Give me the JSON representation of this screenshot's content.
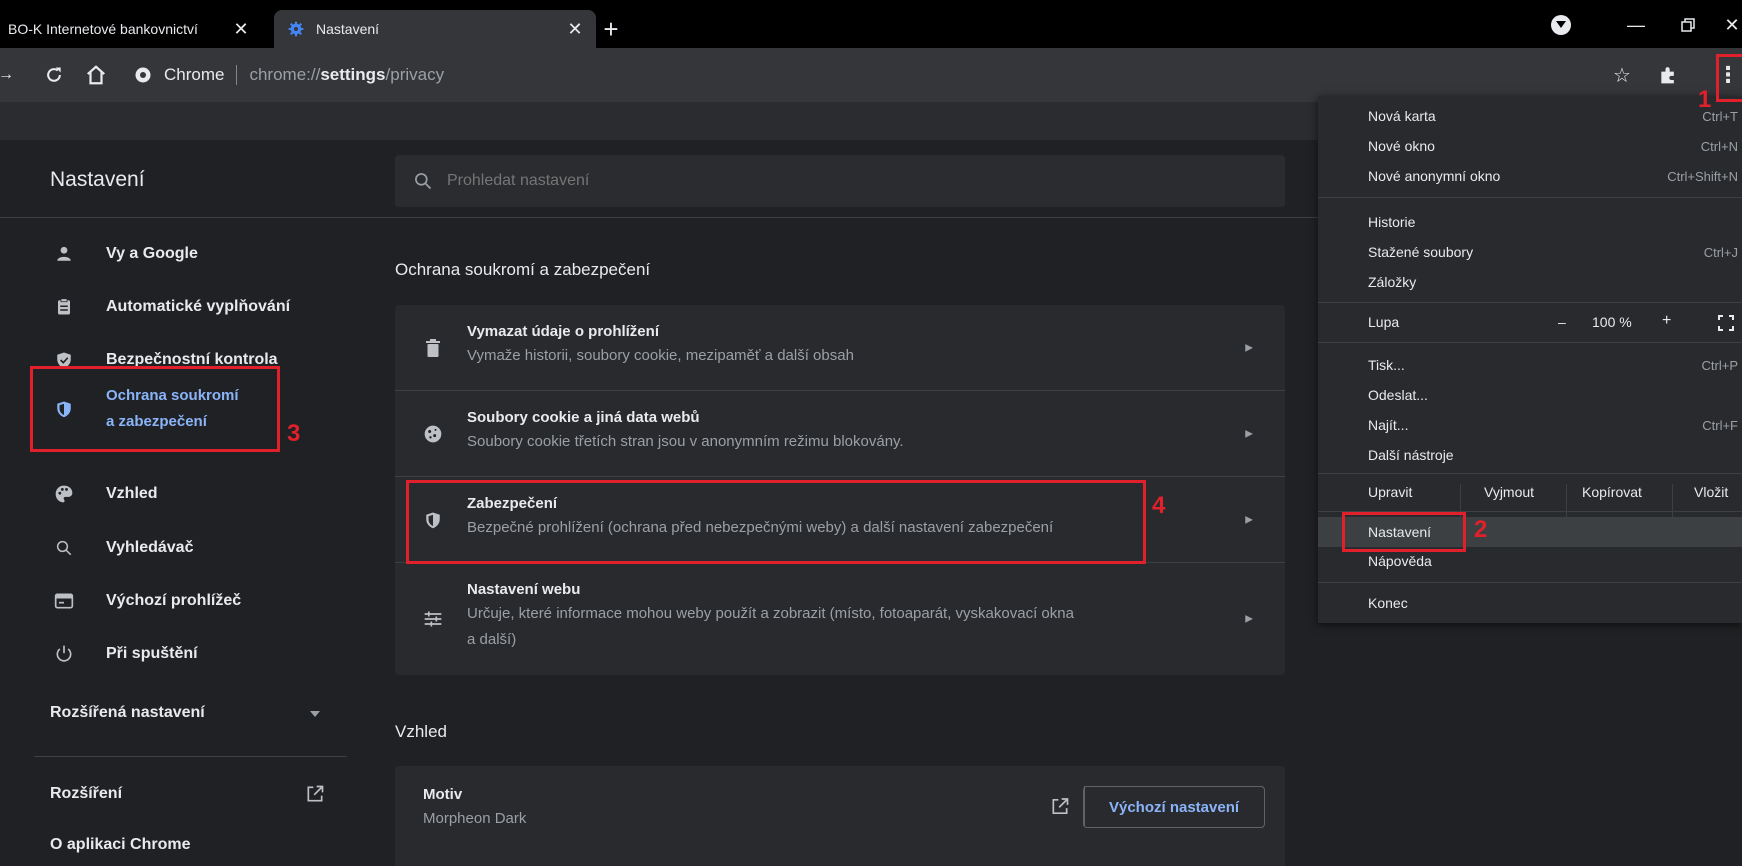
{
  "tabs": [
    {
      "title": "BO-K Internetové bankovnictví"
    },
    {
      "title": "Nastavení"
    }
  ],
  "toolbar": {
    "chrome_label": "Chrome",
    "url_scheme": "chrome://",
    "url_host": "settings",
    "url_path": "/privacy"
  },
  "settings": {
    "title": "Nastavení",
    "search_placeholder": "Prohledat nastavení"
  },
  "sidebar": {
    "items": [
      {
        "label": "Vy a Google",
        "icon": "person-icon"
      },
      {
        "label": "Automatické vyplňování",
        "icon": "clipboard-icon"
      },
      {
        "label": "Bezpečnostní kontrola",
        "icon": "shield-check-icon"
      },
      {
        "label": "Ochrana soukromí",
        "label2": "a zabezpečení",
        "icon": "shield-icon"
      },
      {
        "label": "Vzhled",
        "icon": "palette-icon"
      },
      {
        "label": "Vyhledávač",
        "icon": "search-icon"
      },
      {
        "label": "Výchozí prohlížeč",
        "icon": "browser-icon"
      },
      {
        "label": "Při spuštění",
        "icon": "power-icon"
      }
    ],
    "advanced": "Rozšířená nastavení",
    "extensions": "Rozšíření",
    "about": "O aplikaci Chrome"
  },
  "privacy": {
    "section_title": "Ochrana soukromí a zabezpečení",
    "rows": [
      {
        "title": "Vymazat údaje o prohlížení",
        "subtitle": "Vymaže historii, soubory cookie, mezipaměť a další obsah"
      },
      {
        "title": "Soubory cookie a jiná data webů",
        "subtitle": "Soubory cookie třetích stran jsou v anonymním režimu blokovány."
      },
      {
        "title": "Zabezpečení",
        "subtitle": "Bezpečné prohlížení (ochrana před nebezpečnými weby) a další nastavení zabezpečení"
      },
      {
        "title": "Nastavení webu",
        "subtitle": "Určuje, které informace mohou weby použít a zobrazit (místo, fotoaparát, vyskakovací okna",
        "subtitle2": "a další)"
      }
    ]
  },
  "appearance": {
    "section_title": "Vzhled",
    "theme_title": "Motiv",
    "theme_value": "Morpheon Dark",
    "default_button": "Výchozí nastavení"
  },
  "menu": {
    "items": [
      {
        "label": "Nová karta",
        "shortcut": "Ctrl+T"
      },
      {
        "label": "Nové okno",
        "shortcut": "Ctrl+N"
      },
      {
        "label": "Nové anonymní okno",
        "shortcut": "Ctrl+Shift+N"
      },
      {
        "label": "Historie",
        "shortcut": ""
      },
      {
        "label": "Stažené soubory",
        "shortcut": "Ctrl+J"
      },
      {
        "label": "Záložky",
        "shortcut": ""
      },
      {
        "label": "Tisk...",
        "shortcut": "Ctrl+P"
      },
      {
        "label": "Odeslat...",
        "shortcut": ""
      },
      {
        "label": "Najít...",
        "shortcut": "Ctrl+F"
      },
      {
        "label": "Další nástroje",
        "shortcut": ""
      },
      {
        "label": "Nastavení",
        "shortcut": ""
      },
      {
        "label": "Nápověda",
        "shortcut": ""
      },
      {
        "label": "Konec",
        "shortcut": ""
      }
    ],
    "zoom": {
      "label": "Lupa",
      "minus": "–",
      "value": "100 %",
      "plus": "+"
    },
    "edit": {
      "label": "Upravit",
      "cut": "Vyjmout",
      "copy": "Kopírovat",
      "paste": "Vložit"
    }
  },
  "annotations": {
    "n1": "1",
    "n2": "2",
    "n3": "3",
    "n4": "4"
  },
  "colors": {
    "accent": "#8ab4f8",
    "annotation": "#e0202a",
    "background": "#202124"
  }
}
